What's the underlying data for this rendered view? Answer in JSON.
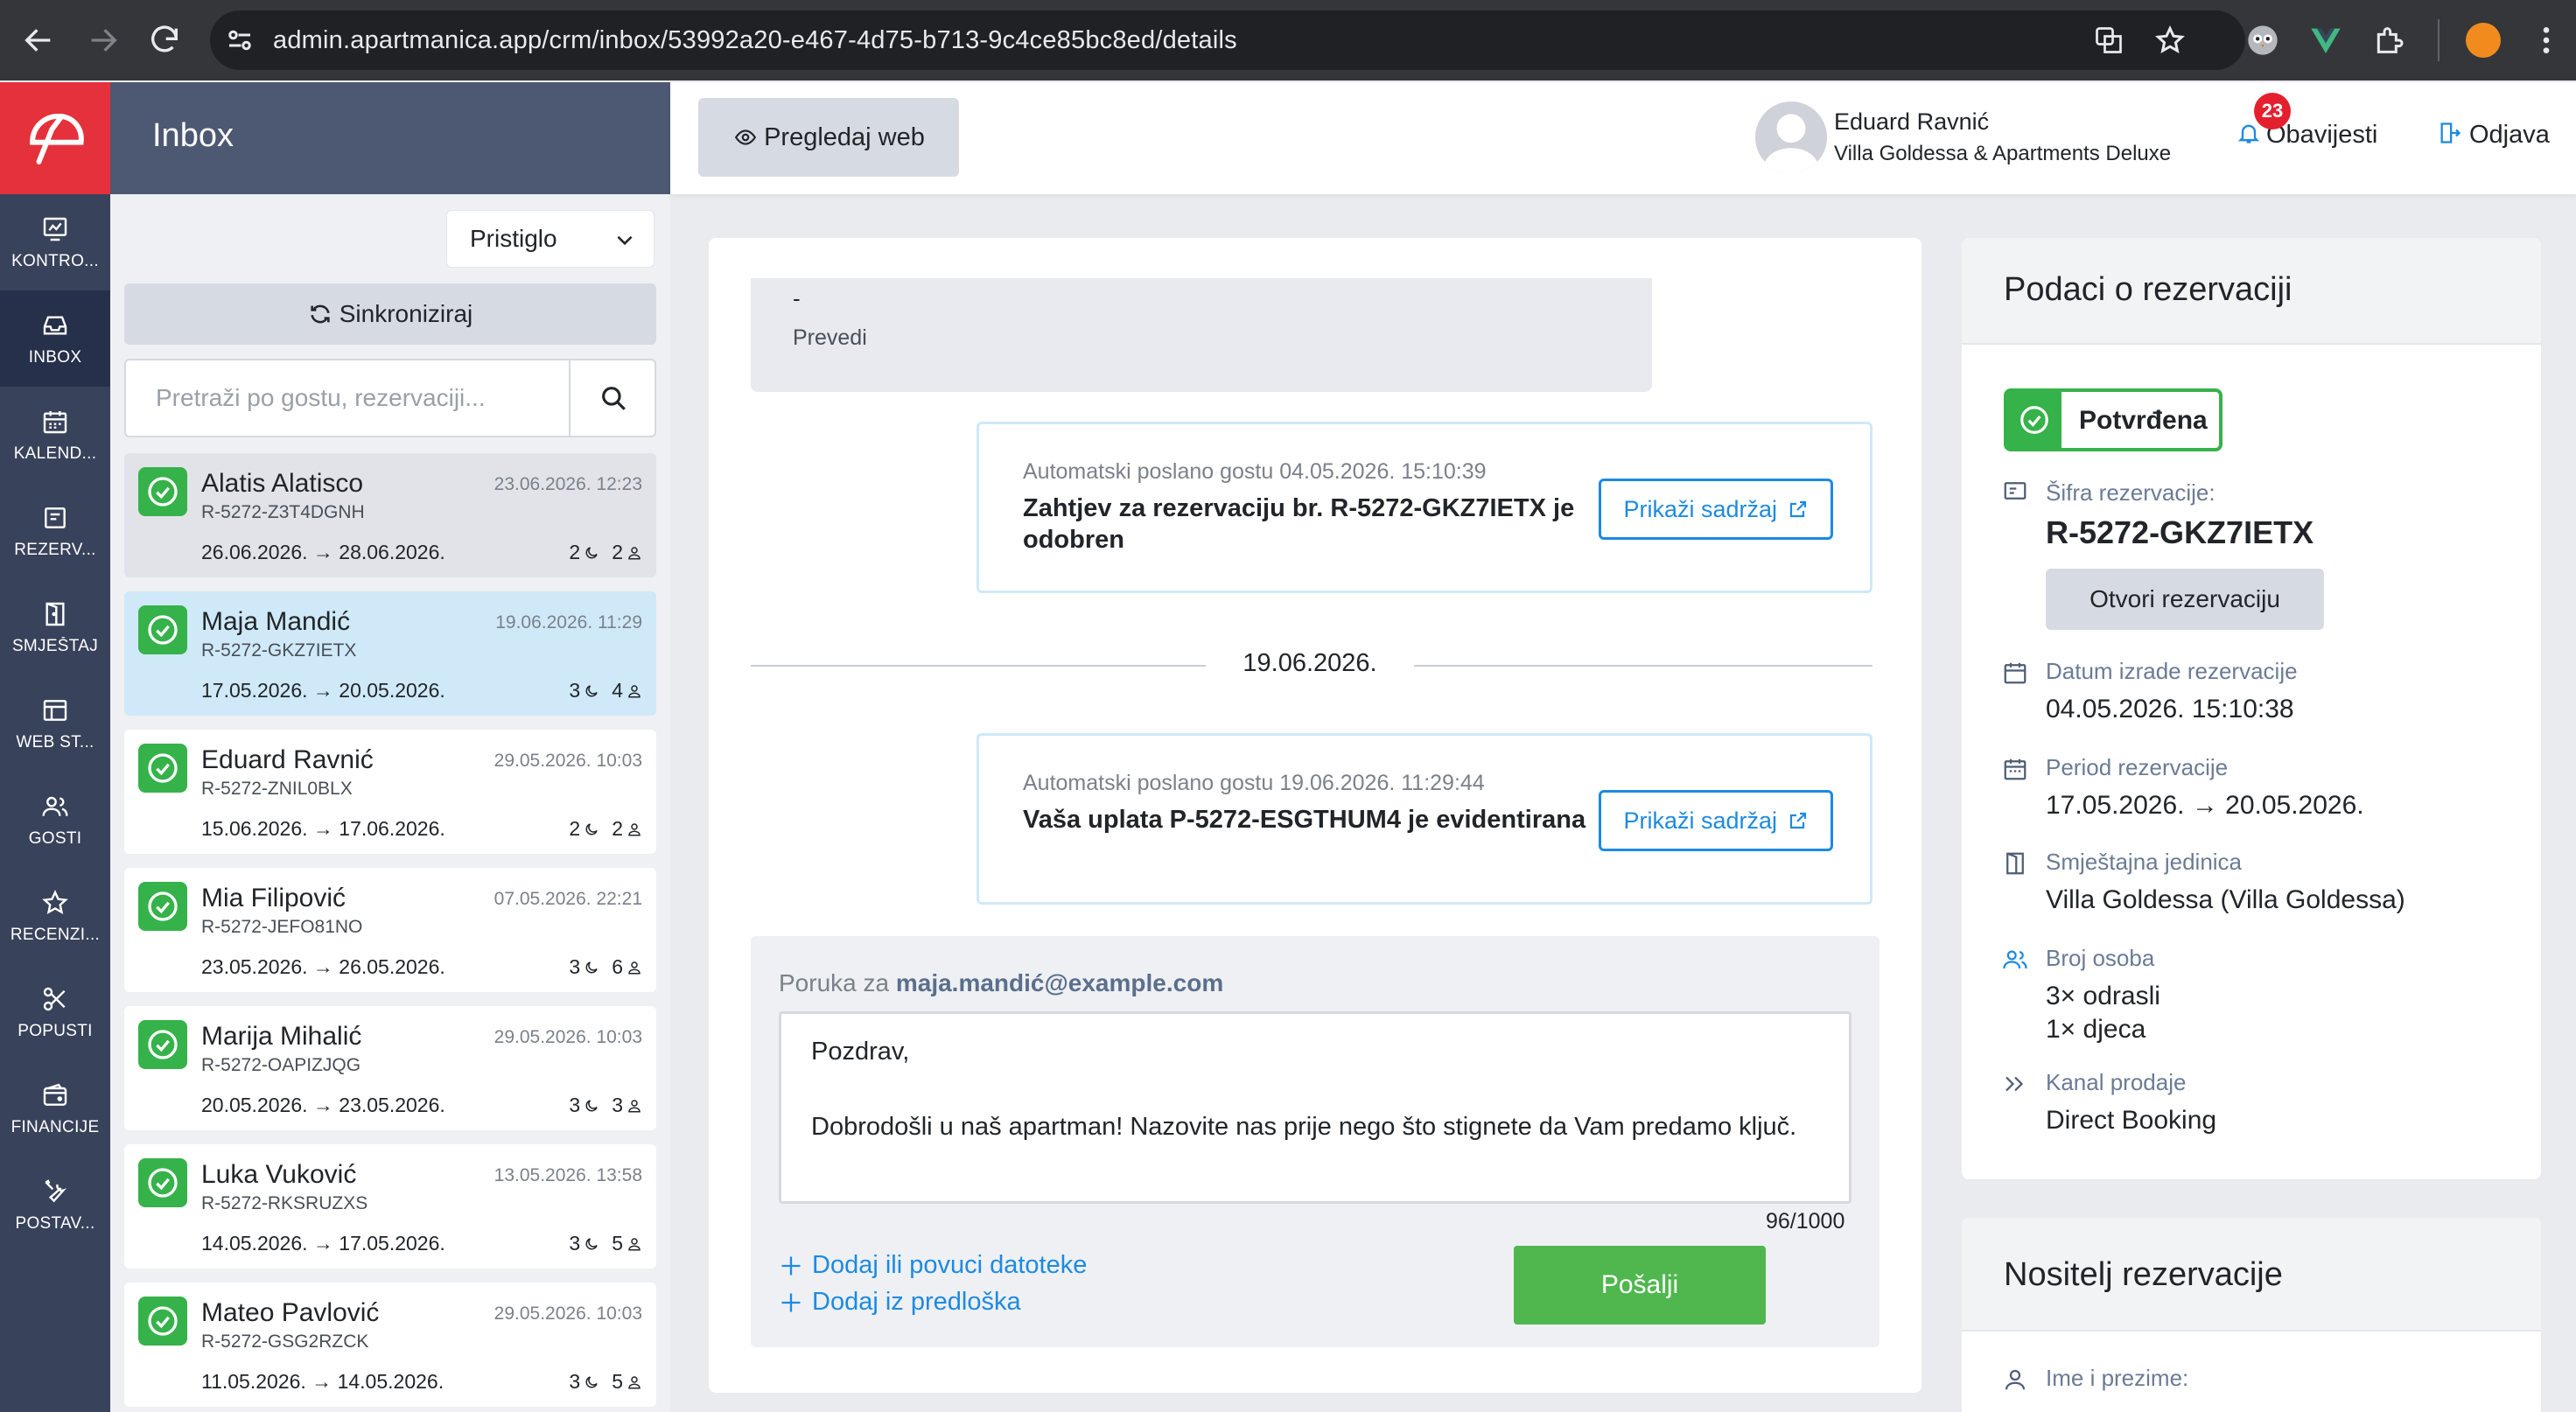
{
  "browser": {
    "url": "admin.apartmanica.app/crm/inbox/53992a20-e467-4d75-b713-9c4ce85bc8ed/details"
  },
  "nav": {
    "items": [
      {
        "label": "KONTRO...",
        "icon": "dashboard-icon"
      },
      {
        "label": "INBOX",
        "icon": "inbox-icon"
      },
      {
        "label": "KALEND...",
        "icon": "calendar-icon"
      },
      {
        "label": "REZERV...",
        "icon": "reservation-icon"
      },
      {
        "label": "SMJEŠTAJ",
        "icon": "door-icon"
      },
      {
        "label": "WEB ST...",
        "icon": "web-icon"
      },
      {
        "label": "GOSTI",
        "icon": "guests-icon"
      },
      {
        "label": "RECENZI...",
        "icon": "star-icon"
      },
      {
        "label": "POPUSTI",
        "icon": "scissors-icon"
      },
      {
        "label": "FINANCIJE",
        "icon": "wallet-icon"
      },
      {
        "label": "POSTAV...",
        "icon": "tools-icon"
      }
    ]
  },
  "inbox": {
    "title": "Inbox",
    "filter": "Pristiglo",
    "sync_label": "Sinkroniziraj",
    "search_placeholder": "Pretraži po gostu, rezervaciji...",
    "conversations": [
      {
        "name": "Alatis Alatisco",
        "date": "23.06.2026. 12:23",
        "code": "R-5272-Z3T4DGNH",
        "range": "26.06.2026. → 28.06.2026.",
        "nights": "2",
        "guests": "2"
      },
      {
        "name": "Maja Mandić",
        "date": "19.06.2026. 11:29",
        "code": "R-5272-GKZ7IETX",
        "range": "17.05.2026. → 20.05.2026.",
        "nights": "3",
        "guests": "4"
      },
      {
        "name": "Eduard Ravnić",
        "date": "29.05.2026. 10:03",
        "code": "R-5272-ZNIL0BLX",
        "range": "15.06.2026. → 17.06.2026.",
        "nights": "2",
        "guests": "2"
      },
      {
        "name": "Mia Filipović",
        "date": "07.05.2026. 22:21",
        "code": "R-5272-JEFO81NO",
        "range": "23.05.2026. → 26.05.2026.",
        "nights": "3",
        "guests": "6"
      },
      {
        "name": "Marija Mihalić",
        "date": "29.05.2026. 10:03",
        "code": "R-5272-OAPIZJQG",
        "range": "20.05.2026. → 23.05.2026.",
        "nights": "3",
        "guests": "3"
      },
      {
        "name": "Luka Vuković",
        "date": "13.05.2026. 13:58",
        "code": "R-5272-RKSRUZXS",
        "range": "14.05.2026. → 17.05.2026.",
        "nights": "3",
        "guests": "5"
      },
      {
        "name": "Mateo Pavlović",
        "date": "29.05.2026. 10:03",
        "code": "R-5272-GSG2RZCK",
        "range": "11.05.2026. → 14.05.2026.",
        "nights": "3",
        "guests": "5"
      }
    ]
  },
  "topbar": {
    "preview_label": "Pregledaj web",
    "user_name": "Eduard Ravnić",
    "user_org": "Villa Goldessa & Apartments Deluxe",
    "notifications_label": "Obavijesti",
    "notifications_count": "23",
    "logout_label": "Odjava"
  },
  "thread": {
    "partial_dash": "-",
    "translate_label": "Prevedi",
    "auto_messages": [
      {
        "meta": "Automatski poslano gostu 04.05.2026. 15:10:39",
        "title": "Zahtjev za rezervaciju br. R-5272-GKZ7IETX je odobren",
        "button": "Prikaži sadržaj"
      },
      {
        "meta": "Automatski poslano gostu 19.06.2026. 11:29:44",
        "title": "Vaša uplata P-5272-ESGTHUM4 je evidentirana",
        "button": "Prikaži sadržaj"
      }
    ],
    "date_separator": "19.06.2026."
  },
  "composer": {
    "label_prefix": "Poruka za",
    "recipient": "maja.mandić@example.com",
    "text": "Pozdrav,\n\nDobrodošli u naš apartman! Nazovite nas prije nego što stignete da Vam predamo ključ.",
    "counter": "96/1000",
    "attach_label": "Dodaj ili povuci datoteke",
    "template_label": "Dodaj iz predloška",
    "send_label": "Pošalji"
  },
  "reservation": {
    "title": "Podaci o rezervaciji",
    "status": "Potvrđena",
    "code_label": "Šifra rezervacije:",
    "code": "R-5272-GKZ7IETX",
    "open_label": "Otvori rezervaciju",
    "created_label": "Datum izrade rezervacije",
    "created": "04.05.2026. 15:10:38",
    "period_label": "Period rezervacije",
    "period": "17.05.2026. → 20.05.2026.",
    "unit_label": "Smještajna jedinica",
    "unit": "Villa Goldessa (Villa Goldessa)",
    "persons_label": "Broj osoba",
    "adults": "3× odrasli",
    "children": "1× djeca",
    "channel_label": "Kanal prodaje",
    "channel": "Direct Booking"
  },
  "holder": {
    "title": "Nositelj rezervacije",
    "name_label": "Ime i prezime:"
  },
  "colors": {
    "brand_red": "#e5313c",
    "nav_bg": "#38425a",
    "success": "#36b24a",
    "link": "#1d8ae0",
    "send": "#4fb74e",
    "selected_card": "#cfe9f8"
  }
}
